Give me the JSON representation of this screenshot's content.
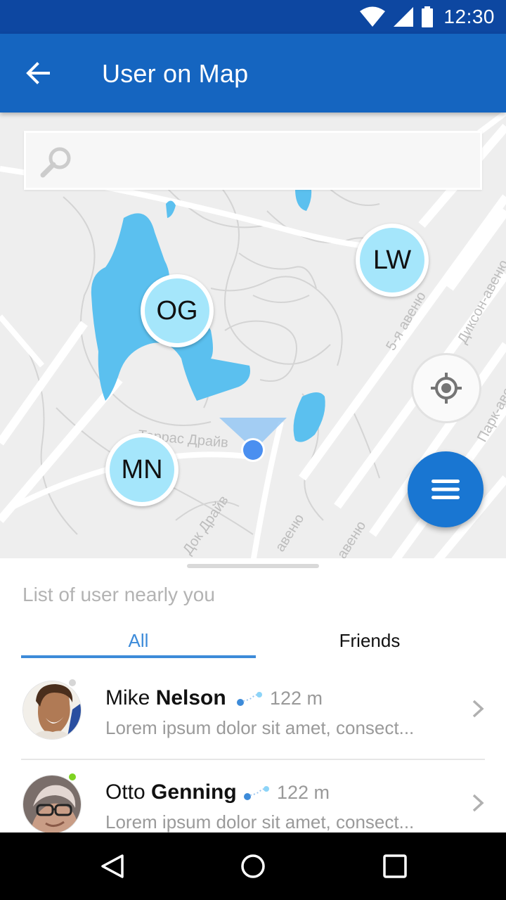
{
  "status_bar": {
    "time": "12:30"
  },
  "app_bar": {
    "title": "User on Map"
  },
  "search": {
    "placeholder": "",
    "value": ""
  },
  "map": {
    "markers": [
      {
        "initials": "OG"
      },
      {
        "initials": "LW"
      },
      {
        "initials": "MN"
      }
    ],
    "street_labels": [
      "Террас Драйв",
      "5-я авеню",
      "Диксон-авеню",
      "Парк-авеню",
      "Док Драйв",
      "авеню",
      "авеню"
    ]
  },
  "sheet": {
    "title": "List of user nearly you",
    "tabs": [
      {
        "label": "All",
        "active": true
      },
      {
        "label": "Friends",
        "active": false
      }
    ],
    "users": [
      {
        "first_name": "Mike",
        "last_name": "Nelson",
        "distance": "122 m",
        "description": "Lorem ipsum dolor sit amet, consect...",
        "online": false
      },
      {
        "first_name": "Otto",
        "last_name": "Genning",
        "distance": "122 m",
        "description": "Lorem ipsum dolor sit amet, consect...",
        "online": true
      }
    ]
  },
  "colors": {
    "status_bar": "#0d47a1",
    "app_bar": "#1565c0",
    "accent": "#3d8bd9",
    "marker_fill": "#a5e6fb",
    "water": "#5bc0ef",
    "online": "#7ed321",
    "offline": "#d6d6d6"
  }
}
